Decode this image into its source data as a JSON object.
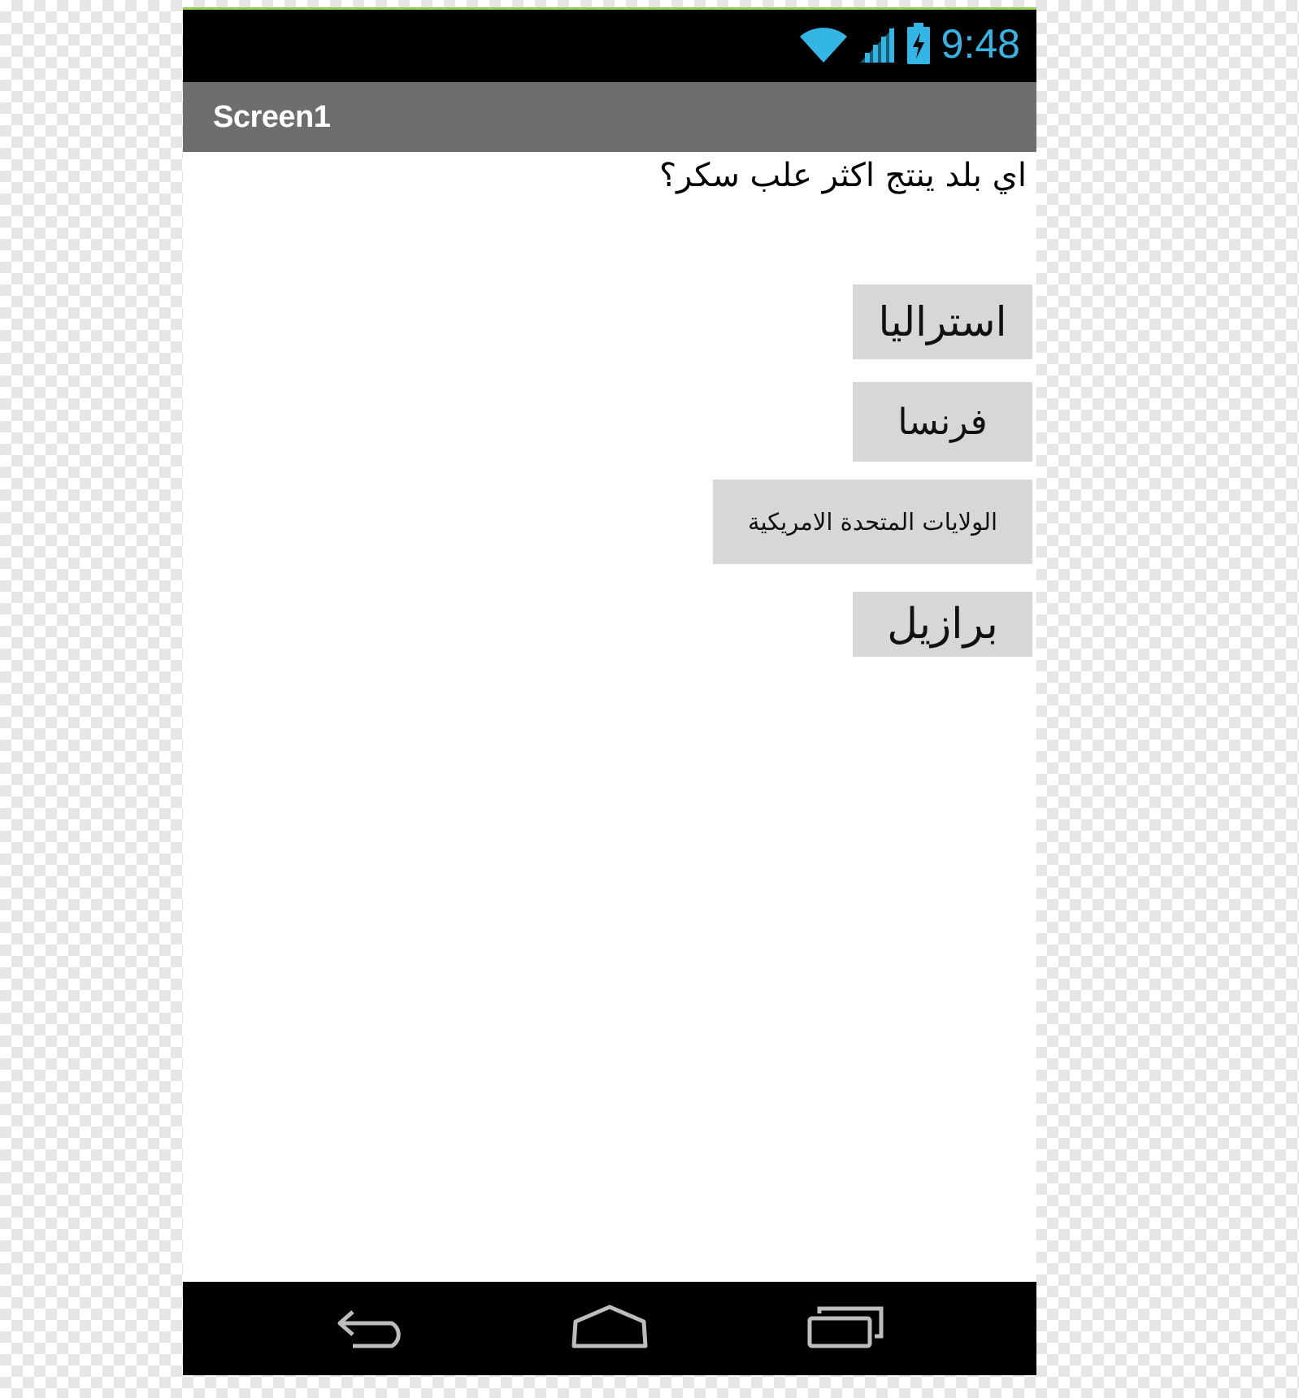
{
  "status_bar": {
    "time": "9:48",
    "icons": [
      "wifi-icon",
      "cell-signal-icon",
      "battery-charging-icon"
    ],
    "accent_color": "#33b5e5"
  },
  "action_bar": {
    "title": "Screen1",
    "background": "#6e6e6e"
  },
  "quiz": {
    "question": "اي بلد ينتج اكثر علب سكر؟",
    "answers": [
      {
        "label": "استراليا"
      },
      {
        "label": "فرنسا"
      },
      {
        "label": "الولايات المتحدة الامريكية"
      },
      {
        "label": "برازيل"
      }
    ],
    "button_color": "#d6d7d7"
  },
  "nav_bar": {
    "icons": [
      "back-icon",
      "home-icon",
      "recent-apps-icon"
    ]
  }
}
